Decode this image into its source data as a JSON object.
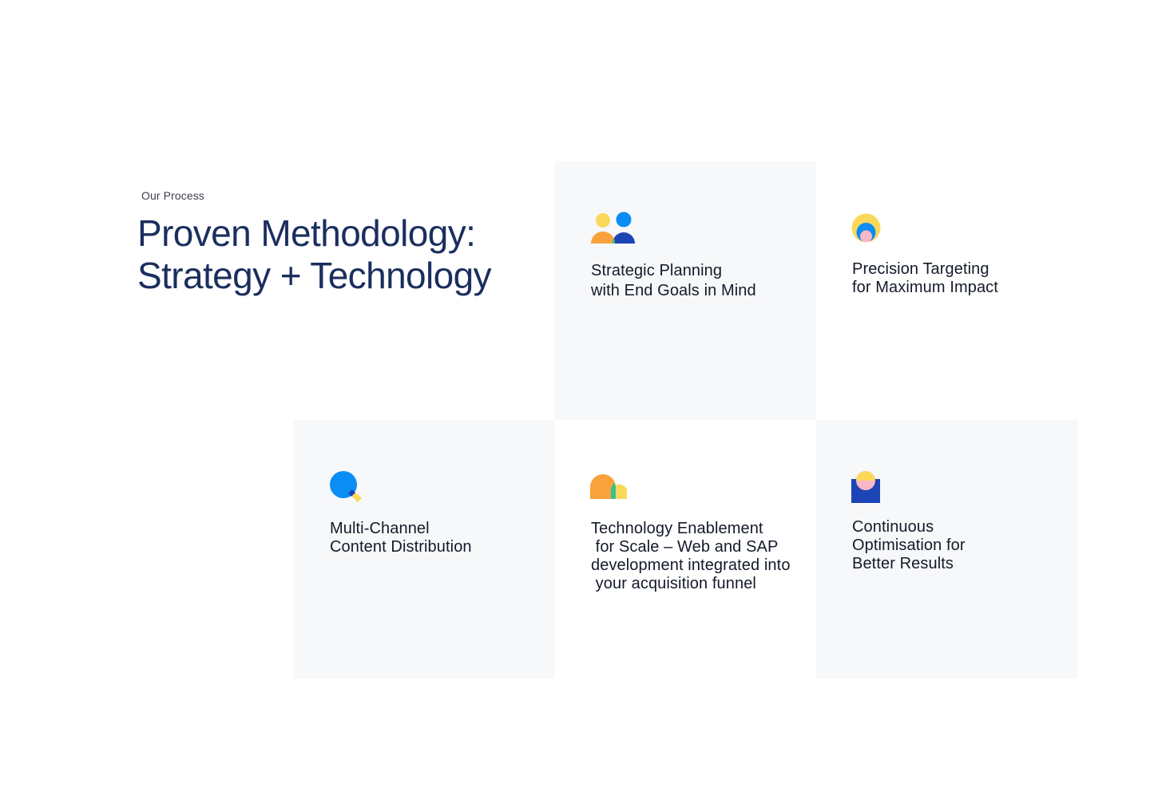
{
  "section": {
    "eyebrow": "Our Process",
    "headline_line1": "Proven Methodology:",
    "headline_line2": "Strategy + Technology"
  },
  "steps": [
    {
      "icon": "people-icon",
      "label": "Strategic Planning\nwith End Goals in Mind"
    },
    {
      "icon": "target-icon",
      "label": "Precision Targeting\nfor Maximum Impact"
    },
    {
      "icon": "search-icon",
      "label": "Multi-Channel\nContent Distribution"
    },
    {
      "icon": "chat-bubbles-icon",
      "label": "Technology Enablement\n for Scale – Web and SAP\ndevelopment integrated into\n your acquisition funnel"
    },
    {
      "icon": "optimisation-icon",
      "label": "Continuous\nOptimisation for\nBetter Results"
    }
  ],
  "colors": {
    "headline": "#1b2e5e",
    "tile_background": "#f7f8f9",
    "yellow": "#fcd85a",
    "orange": "#f9a23b",
    "blue": "#0a8df5",
    "navy": "#1c44b4",
    "green": "#35c28f",
    "pink": "#f7b7c6"
  }
}
